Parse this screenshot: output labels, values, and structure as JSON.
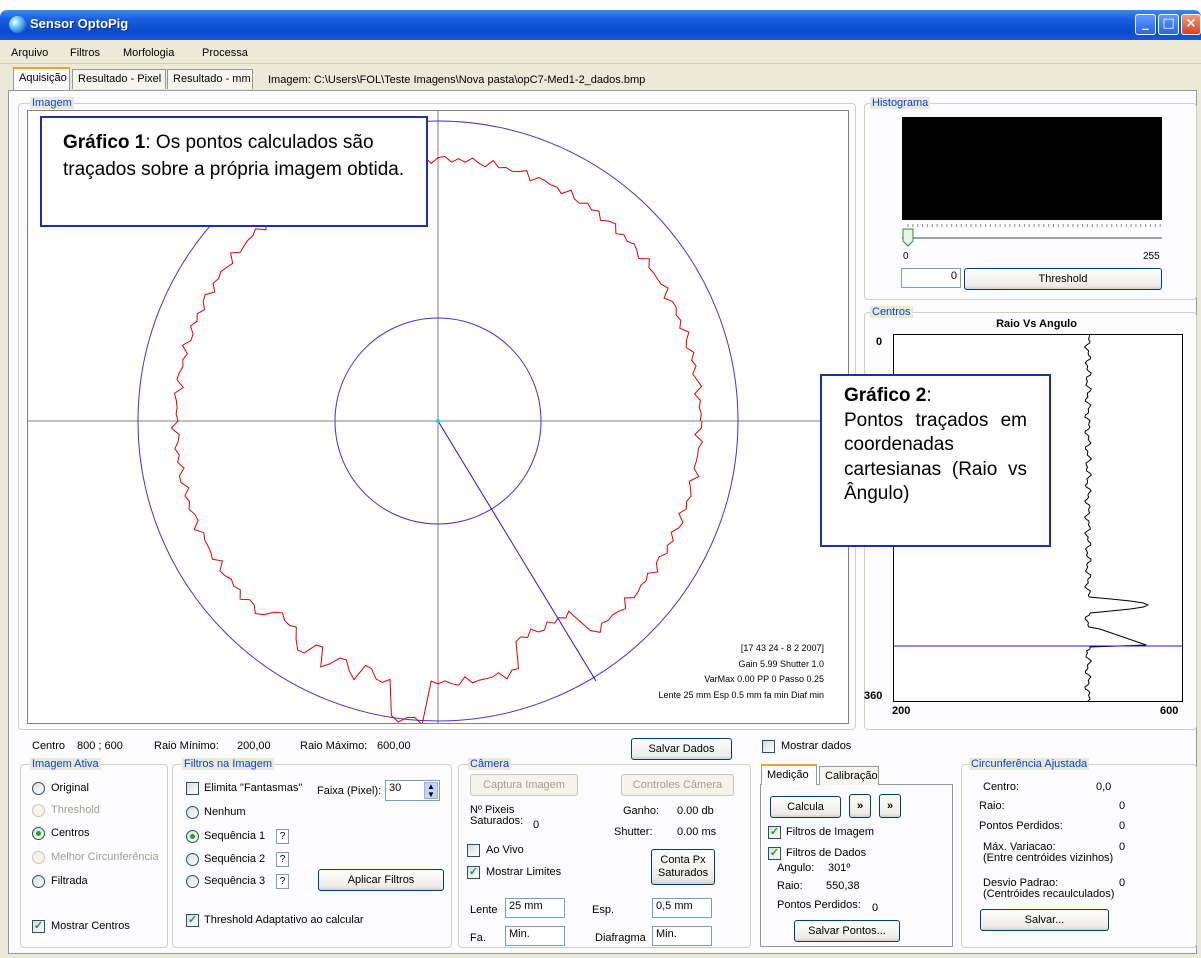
{
  "window": {
    "title": "Sensor OptoPig"
  },
  "menu": [
    "Arquivo",
    "Filtros",
    "Morfologia",
    "Processa"
  ],
  "tabs": [
    "Aquisição",
    "Resultado - Pixel",
    "Resultado - mm"
  ],
  "image_path": "Imagem:  C:\\Users\\FOL\\Teste Imagens\\Nova pasta\\opC7-Med1-2_dados.bmp",
  "imagem_group": {
    "label": "Imagem",
    "annotation_bold": "Gráfico 1",
    "annotation_text": ": Os pontos calculados são traçados sobre a própria imagem obtida.",
    "overlay": [
      "[17 43 24 - 8 2 2007]",
      "Gain  5.99   Shutter  1.0",
      "VarMax  0.00   PP  0   Passo  0.25",
      "Lente  25 mm   Esp 0.5 mm   fa  min   Diaf  min"
    ]
  },
  "status": {
    "centro_label": "Centro",
    "centro_value": "800 ; 600",
    "raio_min_label": "Raio Mínimo:",
    "raio_min_value": "200,00",
    "raio_max_label": "Raio Máximo:",
    "raio_max_value": "600,00",
    "salvar_dados": "Salvar Dados",
    "mostrar_dados": "Mostrar dados"
  },
  "histograma": {
    "label": "Histograma",
    "min": "0",
    "max": "255",
    "threshold_value": "0",
    "threshold_button": "Threshold"
  },
  "centros": {
    "label": "Centros",
    "chart_title": "Raio Vs Angulo",
    "y_top": "0",
    "y_bottom": "360",
    "x_left": "200",
    "x_right": "600",
    "annotation_bold": "Gráfico 2",
    "annotation_text": "Pontos traçados em coordenadas cartesianas (Raio vs Ângulo)"
  },
  "imagem_ativa": {
    "label": "Imagem Ativa",
    "options": [
      "Original",
      "Threshold",
      "Centros",
      "Melhor Circunferência",
      "Filtrada"
    ],
    "mostrar_centros": "Mostrar Centros"
  },
  "filtros": {
    "label": "Filtros na Imagem",
    "elimita": "Elimita \"Fantasmas\"",
    "faixa_label": "Faixa (Pixel):",
    "faixa_value": "30",
    "options": [
      "Nenhum",
      "Sequência 1",
      "Sequência 2",
      "Sequência 3"
    ],
    "q": "?",
    "aplicar": "Aplicar Filtros",
    "threshold_adaptativo": "Threshold Adaptativo ao calcular"
  },
  "camera": {
    "label": "Câmera",
    "captura": "Captura Imagem",
    "controles": "Controles Câmera",
    "pixeis": "Nº Pixeis",
    "saturados": "Saturados:",
    "saturados_value": "0",
    "ganho_label": "Ganho:",
    "ganho_value": "0.00 db",
    "shutter_label": "Shutter:",
    "shutter_value": "0.00 ms",
    "ao_vivo": "Ao Vivo",
    "mostrar_limites": "Mostrar Limites",
    "conta_px": "Conta Px",
    "conta_px2": "Saturados",
    "lente_label": "Lente",
    "lente_value": "25 mm",
    "esp_label": "Esp.",
    "esp_value": "0,5 mm",
    "fa_label": "Fa.",
    "fa_value": "Min.",
    "diafragma_label": "Diafragma",
    "diafragma_value": "Min."
  },
  "medicao": {
    "tabs": [
      "Medição",
      "Calibração"
    ],
    "calcula": "Calcula",
    "next1": "»",
    "next2": "»",
    "filtros_imagem": "Filtros de Imagem",
    "filtros_dados": "Filtros de Dados",
    "angulo_label": "Angulo:",
    "angulo_value": "301º",
    "raio_label": "Raio:",
    "raio_value": "550,38",
    "perdidos_label": "Pontos Perdidos:",
    "perdidos_value": "0",
    "salvar_pontos": "Salvar Pontos..."
  },
  "circunferencia": {
    "label": "Circunferência Ajustada",
    "centro_label": "Centro:",
    "centro_value": "0,0",
    "raio_label": "Raio:",
    "raio_value": "0",
    "perdidos_label": "Pontos Perdidos:",
    "perdidos_value": "0",
    "variacao_label": "Máx. Variacao:",
    "variacao_sub": "(Entre centróides vizinhos)",
    "variacao_value": "0",
    "desvio_label": "Desvio Padrao:",
    "desvio_sub": "(Centróides recaulculados)",
    "desvio_value": "0",
    "salvar": "Salvar..."
  },
  "colors": {
    "titlebar": "#0b4bd0",
    "group_label": "#0046d5",
    "red_curve": "#e00000",
    "purple_circle": "#4a2fd0",
    "annotation_border": "#1f2fa8"
  }
}
